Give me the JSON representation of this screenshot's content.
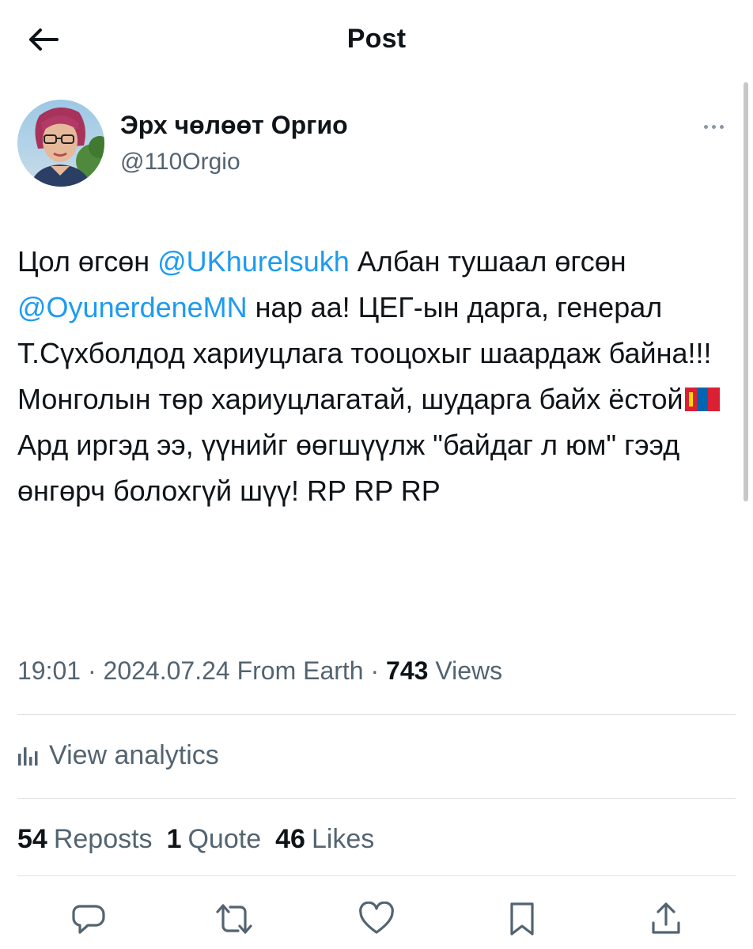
{
  "header": {
    "title": "Post"
  },
  "author": {
    "display_name": "Эрх чөлөөт Оргио",
    "handle": "@110Orgio"
  },
  "tweet": {
    "segments": [
      {
        "text": "Цол өгсөн ",
        "type": "text"
      },
      {
        "text": "@UKhurelsukh",
        "type": "mention"
      },
      {
        "text": "  Албан тушаал өгсөн ",
        "type": "text"
      },
      {
        "text": "@OyunerdeneMN",
        "type": "mention"
      },
      {
        "text": " нар аа! ЦЕГ-ын дарга, генерал Т.Сүхболдод хариуцлага тооцохыг шаардаж байна!!! Монголын төр хариуцлагатай, шударга байх ёстой",
        "type": "text"
      },
      {
        "text": "",
        "type": "flag",
        "emoji": "mongolia-flag-emoji"
      },
      {
        "text": " Ард иргэд ээ, үүнийг өөгшүүлж \"байдаг л юм\" гээд өнгөрч болохгүй шүү! RP RP RP",
        "type": "text"
      }
    ]
  },
  "meta": {
    "time": "19:01",
    "separator": "·",
    "date": "2024.07.24",
    "source": "From Earth",
    "views_count": "743",
    "views_label": "Views"
  },
  "analytics": {
    "label": "View analytics",
    "icon": "analytics-icon"
  },
  "stats": {
    "reposts_count": "54",
    "reposts_label": "Reposts",
    "quote_count": "1",
    "quote_label": "Quote",
    "likes_count": "46",
    "likes_label": "Likes"
  },
  "actions": [
    "reply-icon",
    "repost-icon",
    "like-icon",
    "bookmark-icon",
    "share-icon"
  ],
  "colors": {
    "link": "#1d9bf0",
    "secondary_text": "#536471",
    "primary_text": "#0f1419",
    "divider": "#dfe3e6"
  }
}
